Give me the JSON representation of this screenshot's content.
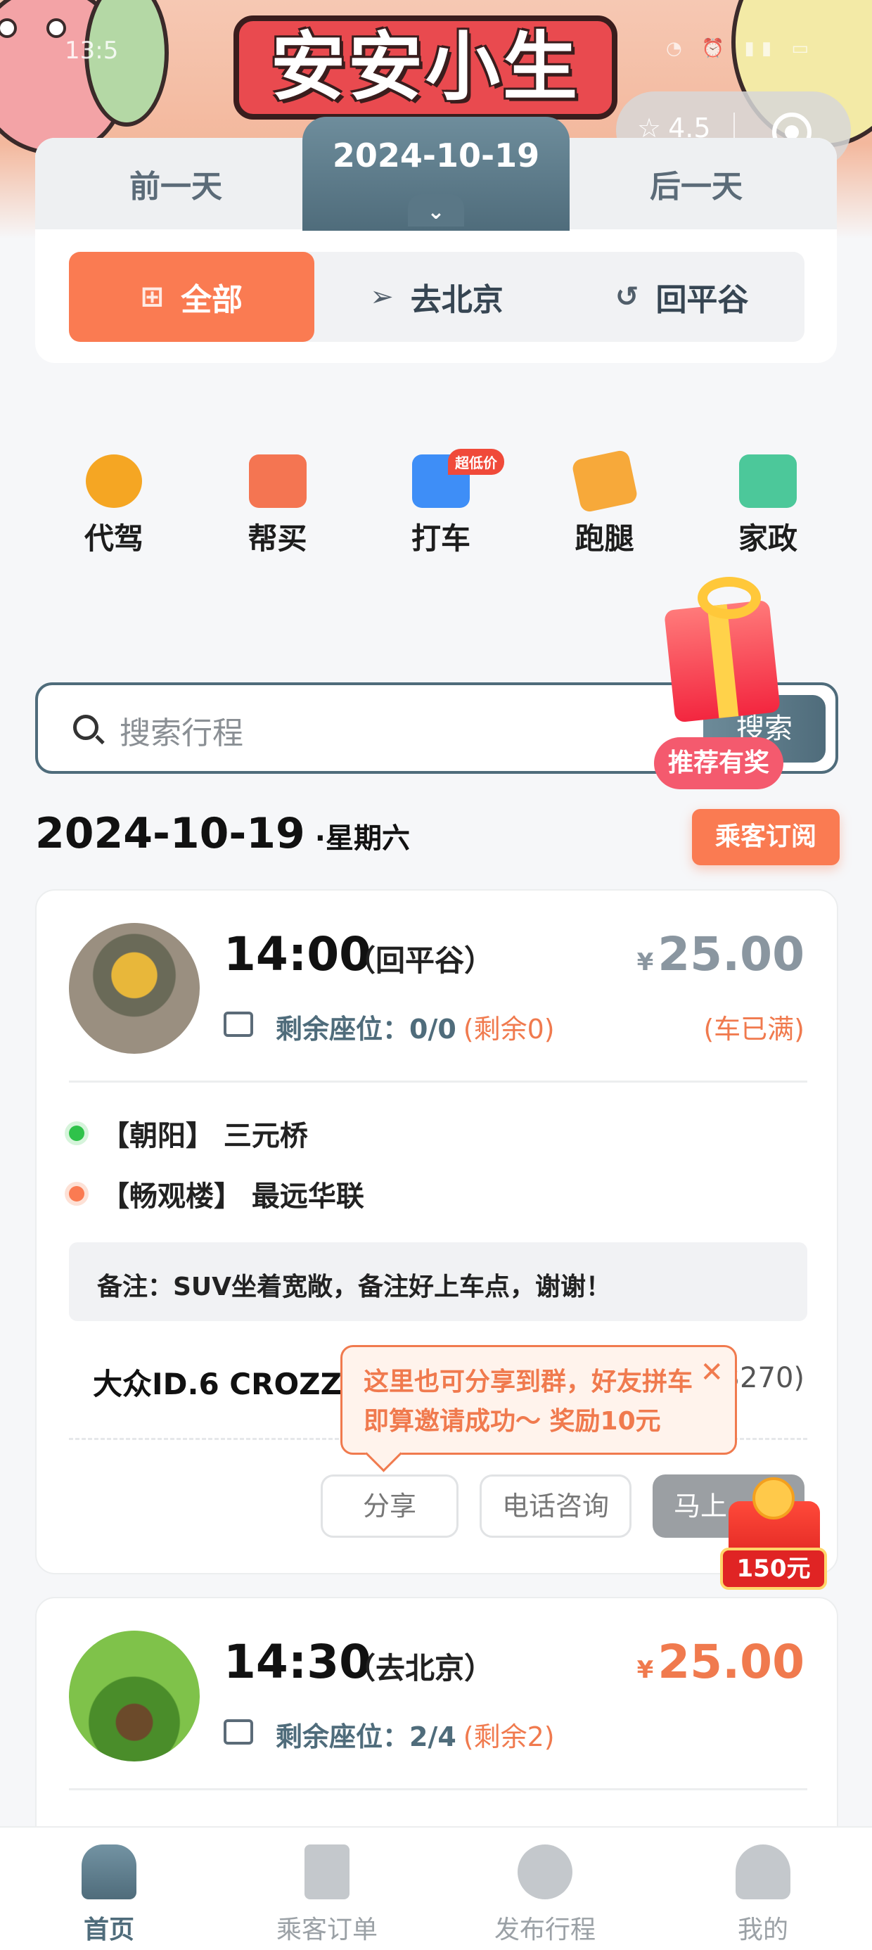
{
  "status_bar": {
    "time": "13:5"
  },
  "app_title": "安安小生活",
  "capsule": {
    "rating": "4.5"
  },
  "date_tabs": {
    "prev": "前一天",
    "current": "2024-10-19",
    "next": "后一天"
  },
  "direction_filter": {
    "items": [
      "全部",
      "去北京",
      "回平谷"
    ],
    "active_index": 0
  },
  "services": [
    {
      "label": "代驾",
      "icon": "steering-wheel-icon",
      "color": "#f5a623"
    },
    {
      "label": "帮买",
      "icon": "shopping-bag-icon",
      "color": "#f47552"
    },
    {
      "label": "打车",
      "icon": "car-icon",
      "color": "#3e8ef7",
      "badge": "超低价"
    },
    {
      "label": "跑腿",
      "icon": "heart-hand-icon",
      "color": "#f7a93a"
    },
    {
      "label": "家政",
      "icon": "shop-icon",
      "color": "#4cc89a"
    }
  ],
  "promo": {
    "gift_label": "推荐有奖",
    "redpack_amount": "150元"
  },
  "search": {
    "placeholder": "搜索行程",
    "button": "搜索"
  },
  "date_heading": {
    "date": "2024-10-19",
    "weekday": "·星期六",
    "subscribe": "乘客订阅"
  },
  "trips": [
    {
      "time": "14:00",
      "direction": "（回平谷）",
      "currency": "¥",
      "price": "25.00",
      "seats_label": "剩余座位：0/0",
      "seats_remaining": "(剩余0)",
      "status": "(车已满)",
      "from": "【朝阳】 三元桥",
      "to": "【畅观楼】 最远华联",
      "note": "备注：SUV坐着宽敞，备注好上车点，谢谢！",
      "car": "大众ID.6 CROZZ",
      "plate_tail": "3270)",
      "actions": {
        "share": "分享",
        "call": "电话咨询",
        "book": "马上"
      }
    },
    {
      "time": "14:30",
      "direction": "（去北京）",
      "currency": "¥",
      "price": "25.00",
      "seats_label": "剩余座位：2/4",
      "seats_remaining": "(剩余2)"
    }
  ],
  "tooltip": {
    "line1": "这里也可分享到群，好友拼车",
    "line2": "即算邀请成功～ 奖励10元",
    "close": "✕"
  },
  "bottom_nav": {
    "items": [
      {
        "label": "首页",
        "icon": "home-icon"
      },
      {
        "label": "乘客订单",
        "icon": "document-icon"
      },
      {
        "label": "发布行程",
        "icon": "driver-icon"
      },
      {
        "label": "我的",
        "icon": "user-icon"
      }
    ],
    "active_index": 0
  }
}
